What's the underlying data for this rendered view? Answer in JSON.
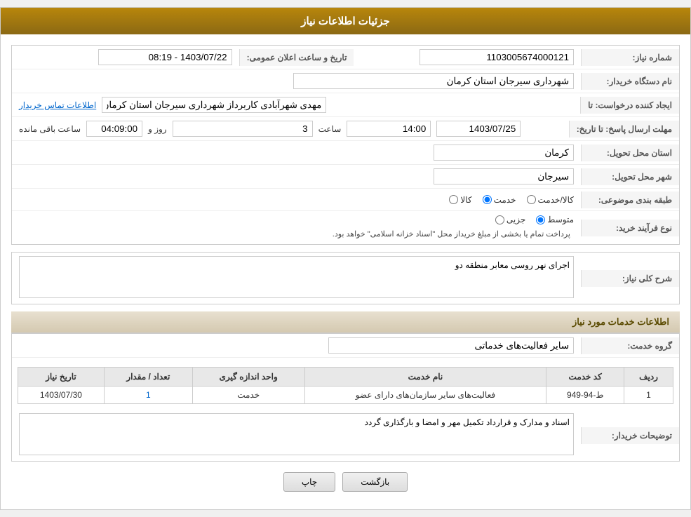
{
  "header": {
    "title": "جزئیات اطلاعات نیاز"
  },
  "form": {
    "fields": {
      "shomareNiaz_label": "شماره نیاز:",
      "shomareNiaz_value": "1103005674000121",
      "namDastgah_label": "نام دستگاه خریدار:",
      "namDastgah_value": "شهرداری سیرجان استان کرمان",
      "tarikh_label": "تاریخ و ساعت اعلان عمومی:",
      "tarikh_value": "1403/07/22 - 08:19",
      "ijaadKonande_label": "ایجاد کننده درخواست: تا",
      "ijaadKonande_value": "مهدی شهرآبادی کاربرداز شهرداری سیرجان استان کرمان",
      "ettelaatTamas_label": "اطلاعات تماس خریدار",
      "mohlat_label": "مهلت ارسال پاسخ: تا تاریخ:",
      "mohlat_date": "1403/07/25",
      "mohlat_saat_label": "ساعت",
      "mohlat_saat_value": "14:00",
      "mohlat_roz_label": "روز و",
      "mohlat_roz_value": "3",
      "mohlat_baqi_label": "ساعت باقی مانده",
      "mohlat_baqi_value": "04:09:00",
      "ostan_label": "استان محل تحویل:",
      "ostan_value": "کرمان",
      "shahr_label": "شهر محل تحویل:",
      "shahr_value": "سیرجان",
      "tabaqe_label": "طبقه بندی موضوعی:",
      "tabaqe_options": [
        {
          "label": "کالا",
          "value": "kala"
        },
        {
          "label": "خدمت",
          "value": "khedmat",
          "selected": true
        },
        {
          "label": "کالا/خدمت",
          "value": "kala_khedmat"
        }
      ],
      "noefarayand_label": "نوع فرآیند خرید:",
      "noefarayand_options": [
        {
          "label": "جزیی",
          "value": "jozi"
        },
        {
          "label": "متوسط",
          "value": "motevaset",
          "selected": true
        }
      ],
      "noefarayand_notice": "پرداخت تمام یا بخشی از مبلغ خریداز محل \"اسناد خزانه اسلامی\" خواهد بود.",
      "sharhKoli_label": "شرح کلی نیاز:",
      "sharhKoli_value": "اجرای نهر روسی معابر منطقه دو"
    },
    "serviceSection": {
      "title": "اطلاعات خدمات مورد نیاز",
      "geroheKhedmat_label": "گروه خدمت:",
      "geroheKhedmat_value": "سایر فعالیت‌های خدماتی",
      "table": {
        "headers": [
          "ردیف",
          "کد خدمت",
          "نام خدمت",
          "واحد اندازه گیری",
          "تعداد / مقدار",
          "تاریخ نیاز"
        ],
        "rows": [
          {
            "radif": "1",
            "kodKhedmat": "ط-94-949",
            "namKhedmat": "فعالیت‌های سایر سازمان‌های دارای عضو",
            "vahed": "خدمت",
            "tedad": "1",
            "tarikh": "1403/07/30"
          }
        ]
      },
      "tozihat_label": "توضیحات خریدار:",
      "tozihat_value": "اسناد و مدارک و قرارداد تکمیل مهر و امضا و بارگذاری گردد"
    },
    "buttons": {
      "print": "چاپ",
      "back": "بازگشت"
    }
  }
}
